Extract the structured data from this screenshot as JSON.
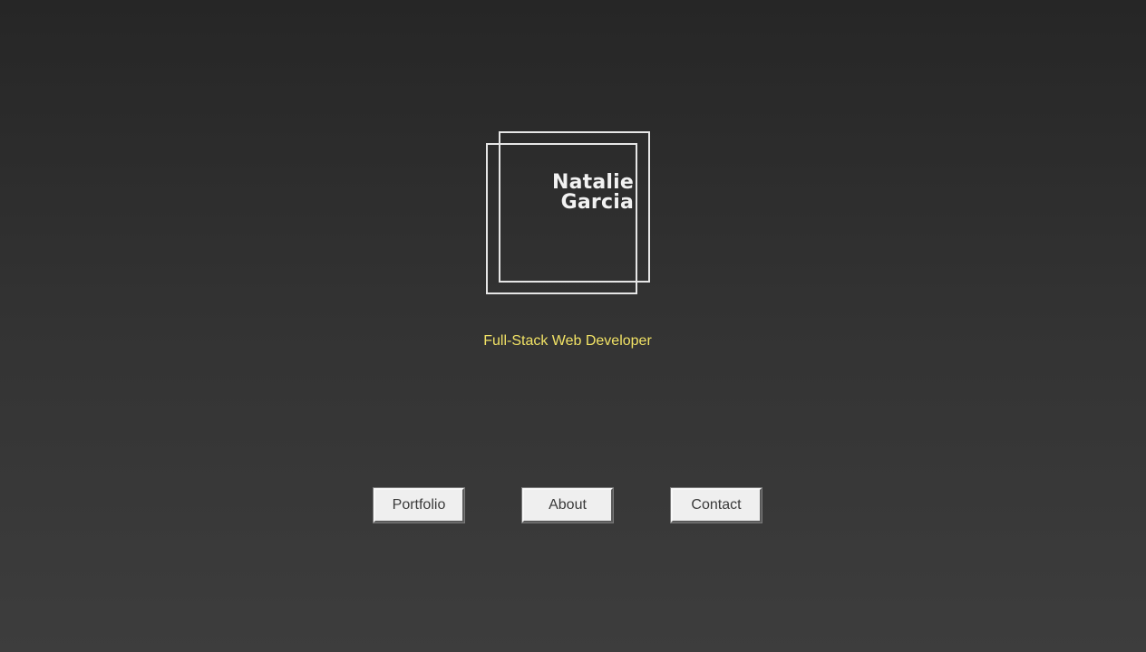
{
  "logo": {
    "first_name": "Natalie",
    "last_name": "Garcia"
  },
  "subtitle": "Full-Stack Web Developer",
  "nav": {
    "portfolio_label": "Portfolio",
    "about_label": "About",
    "contact_label": "Contact"
  },
  "colors": {
    "background_top": "#262626",
    "background_bottom": "#3d3d3d",
    "accent": "#f1e265",
    "frame": "#e6e6e6",
    "button_bg": "#efefef"
  }
}
